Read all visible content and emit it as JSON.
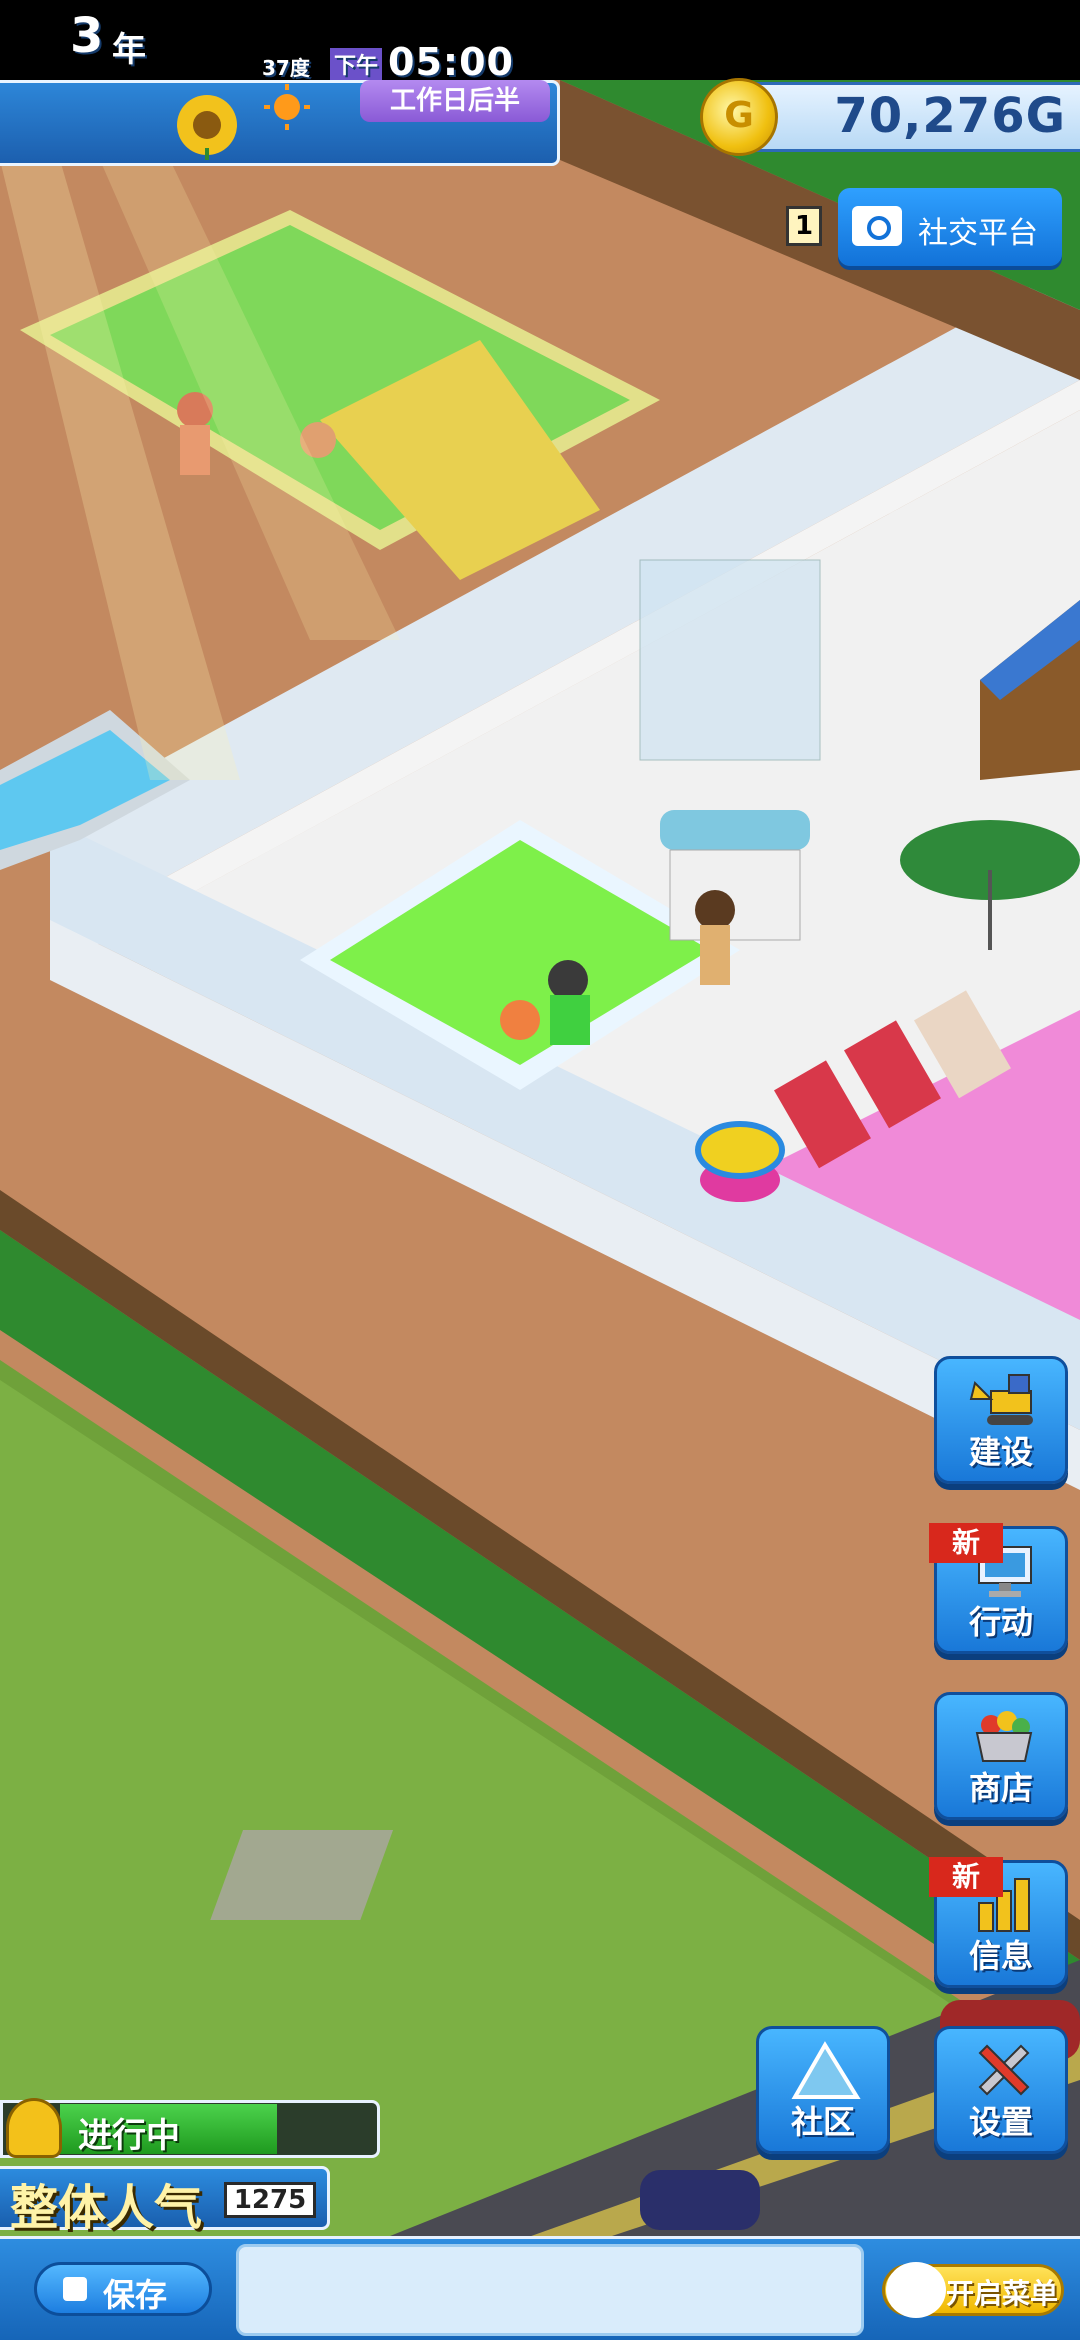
{
  "hud": {
    "year": "3",
    "year_unit": "年",
    "season_icon": "sunflower-icon",
    "weather_icon": "sun-icon",
    "temperature": "37度",
    "period": "工作日后半",
    "ampm": "下午",
    "time": "05:00"
  },
  "money": {
    "coin_icon": "gold-coin-icon",
    "coin_symbol": "G",
    "amount": "70,276G"
  },
  "social": {
    "count": "1",
    "label": "社交平台",
    "icon": "camera-icon"
  },
  "side_menu": {
    "build": "建设",
    "action": "行动",
    "shop": "商店",
    "info": "信息",
    "community": "社区",
    "settings": "设置",
    "new_tag": "新"
  },
  "status": {
    "progress_label": "进行中",
    "progress_level": 0.7,
    "popularity_label": "整体人气",
    "popularity_value": "1275"
  },
  "bottom": {
    "save_label": "保存",
    "menu_label": "开启菜单"
  },
  "colors": {
    "hud_blue": "#1c5fae",
    "accent_purple": "#8a5ad6",
    "gold": "#f0c010",
    "new_red": "#d8281c"
  }
}
